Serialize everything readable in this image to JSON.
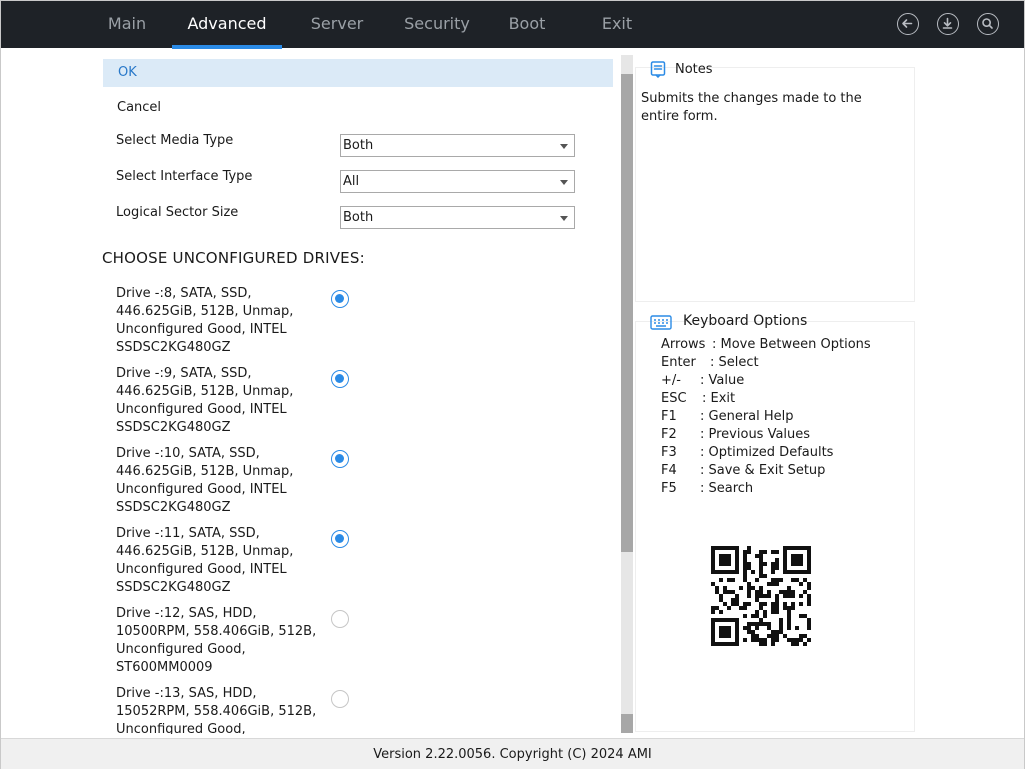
{
  "nav": {
    "tabs": [
      "Main",
      "Advanced",
      "Server",
      "Security",
      "Boot",
      "Exit"
    ],
    "active_index": 1,
    "icons": [
      "back-icon",
      "download-icon",
      "search-icon"
    ]
  },
  "form": {
    "ok_label": "OK",
    "cancel_label": "Cancel",
    "fields": [
      {
        "label": "Select Media Type",
        "value": "Both"
      },
      {
        "label": "Select Interface Type",
        "value": "All"
      },
      {
        "label": "Logical Sector Size",
        "value": "Both"
      }
    ],
    "section_heading": "CHOOSE UNCONFIGURED DRIVES:",
    "drives": [
      {
        "text": "Drive -:8, SATA, SSD,\n446.625GiB, 512B, Unmap,\nUnconfigured Good, INTEL\nSSDSC2KG480GZ",
        "selected": true
      },
      {
        "text": "Drive -:9, SATA, SSD,\n446.625GiB, 512B, Unmap,\nUnconfigured Good, INTEL\nSSDSC2KG480GZ",
        "selected": true
      },
      {
        "text": "Drive -:10, SATA, SSD,\n446.625GiB, 512B, Unmap,\nUnconfigured Good, INTEL\nSSDSC2KG480GZ",
        "selected": true
      },
      {
        "text": "Drive -:11, SATA, SSD,\n446.625GiB, 512B, Unmap,\nUnconfigured Good, INTEL\nSSDSC2KG480GZ",
        "selected": true
      },
      {
        "text": "Drive -:12, SAS, HDD,\n10500RPM, 558.406GiB, 512B,\nUnconfigured Good,\nST600MM0009",
        "selected": false
      },
      {
        "text": "Drive -:13, SAS, HDD,\n15052RPM, 558.406GiB, 512B,\nUnconfigured Good,",
        "selected": false
      }
    ]
  },
  "notes": {
    "title": "Notes",
    "text": "Submits the changes made to the entire form."
  },
  "keyboard": {
    "title": "Keyboard Options",
    "rows": [
      {
        "key": "Arrows",
        "desc": ": Move Between Options"
      },
      {
        "key": "Enter",
        "desc": ": Select"
      },
      {
        "key": "+/-",
        "desc": ": Value"
      },
      {
        "key": "ESC",
        "desc": ": Exit"
      },
      {
        "key": "F1",
        "desc": ": General Help"
      },
      {
        "key": "F2",
        "desc": ": Previous Values"
      },
      {
        "key": "F3",
        "desc": ": Optimized Defaults"
      },
      {
        "key": "F4",
        "desc": ": Save & Exit Setup"
      },
      {
        "key": "F5",
        "desc": ": Search"
      }
    ]
  },
  "footer": {
    "text": "Version 2.22.0056. Copyright (C) 2024 AMI"
  },
  "colors": {
    "accent": "#2b8be6",
    "topbar": "#1e2227",
    "ok_highlight": "#dbeaf7"
  }
}
